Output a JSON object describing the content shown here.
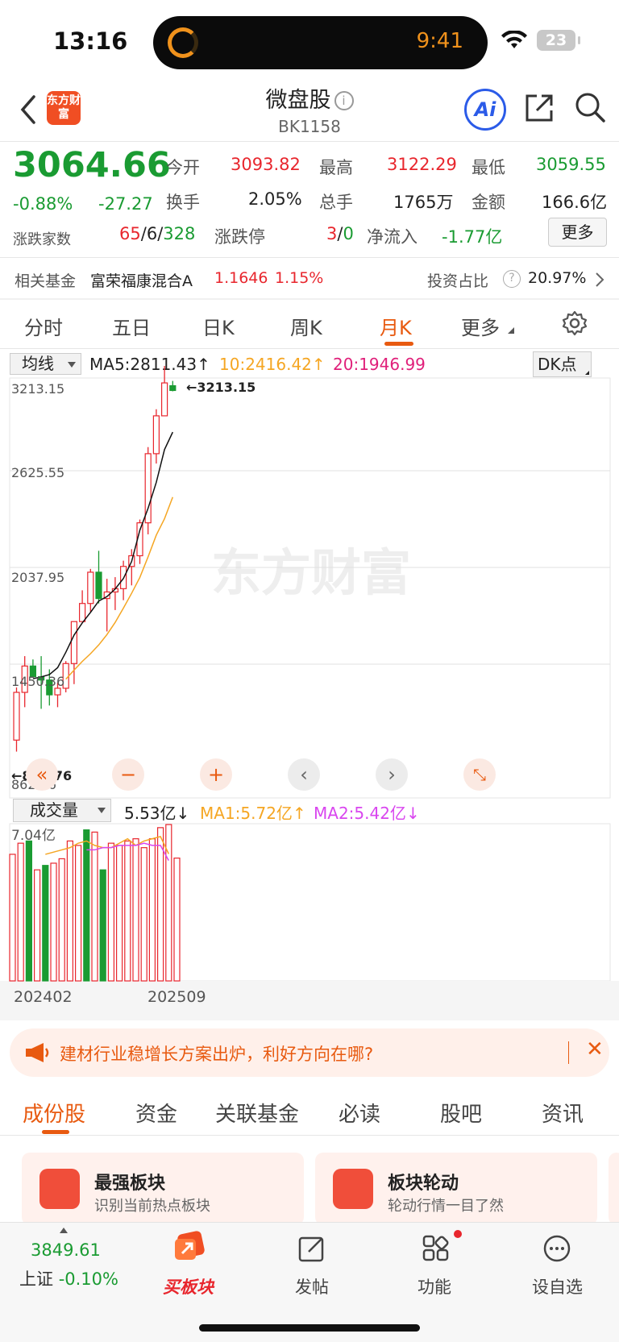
{
  "status_bar": {
    "time": "13:16",
    "island_time": "9:41",
    "battery": "23"
  },
  "header": {
    "logo": "东方财富",
    "title": "微盘股",
    "code": "BK1158",
    "ai_label": "Ai",
    "icons": [
      "back-icon",
      "info-icon",
      "ai-icon",
      "share-icon",
      "search-icon"
    ]
  },
  "quote": {
    "price": "3064.66",
    "change_pct": "-0.88%",
    "change": "-27.27",
    "open_label": "今开",
    "open": "3093.82",
    "high_label": "最高",
    "high": "3122.29",
    "low_label": "最低",
    "low": "3059.55",
    "turnover_label": "换手",
    "turnover": "2.05%",
    "volume_label": "总手",
    "volume": "1765万",
    "amount_label": "金额",
    "amount": "166.6亿",
    "breadth_label": "涨跌家数",
    "breadth_up": "65",
    "breadth_sep1": "/",
    "breadth_flat": "6",
    "breadth_sep2": "/",
    "breadth_down": "328",
    "limit_label": "涨跌停",
    "limit_up": "3",
    "limit_sep": "/",
    "limit_down": "0",
    "netflow_label": "净流入",
    "netflow": "-1.77亿",
    "more_button": "更多"
  },
  "fund": {
    "label": "相关基金",
    "name": "富荣福康混合A",
    "nav": "1.1646",
    "change": "1.15%",
    "ratio_label": "投资占比",
    "ratio": "20.97%"
  },
  "chart_tabs": [
    "分时",
    "五日",
    "日K",
    "周K",
    "月K",
    "更多"
  ],
  "active_chart_tab": "月K",
  "indicators": {
    "ma_select": "均线",
    "ma5": "MA5:2811.43",
    "ma10": "10:2416.42",
    "ma20": "20:1946.99",
    "dk_button": "DK点",
    "vol_select": "成交量",
    "vol": "5.53亿",
    "vol_ma1": "MA1:5.72亿",
    "vol_ma2": "MA2:5.42亿",
    "vol_max": "7.04亿"
  },
  "chart_data": {
    "type": "candlestick",
    "period": "monthly",
    "y_ticks": [
      "3213.15",
      "2625.55",
      "2037.95",
      "1450.36",
      "862.76"
    ],
    "ylim": [
      862.76,
      3213.15
    ],
    "max_marker": "3213.15",
    "min_marker": "862.76",
    "x_ticks": [
      "202402",
      "202509"
    ],
    "candles": [
      {
        "o": 940,
        "h": 1260,
        "l": 870,
        "c": 1230
      },
      {
        "o": 1230,
        "h": 1450,
        "l": 1140,
        "c": 1390
      },
      {
        "o": 1390,
        "h": 1430,
        "l": 1330,
        "c": 1325
      },
      {
        "o": 1325,
        "h": 1450,
        "l": 1130,
        "c": 1305
      },
      {
        "o": 1305,
        "h": 1370,
        "l": 1150,
        "c": 1215
      },
      {
        "o": 1215,
        "h": 1290,
        "l": 1140,
        "c": 1255
      },
      {
        "o": 1255,
        "h": 1420,
        "l": 1230,
        "c": 1405
      },
      {
        "o": 1405,
        "h": 1660,
        "l": 1280,
        "c": 1660
      },
      {
        "o": 1660,
        "h": 1850,
        "l": 1700,
        "c": 1770
      },
      {
        "o": 1770,
        "h": 1980,
        "l": 1720,
        "c": 1960
      },
      {
        "o": 1960,
        "h": 2090,
        "l": 1770,
        "c": 1800
      },
      {
        "o": 1800,
        "h": 1920,
        "l": 1600,
        "c": 1840
      },
      {
        "o": 1840,
        "h": 1930,
        "l": 1730,
        "c": 1860
      },
      {
        "o": 1860,
        "h": 2030,
        "l": 1790,
        "c": 1995
      },
      {
        "o": 1995,
        "h": 2100,
        "l": 1880,
        "c": 2060
      },
      {
        "o": 2060,
        "h": 2280,
        "l": 2010,
        "c": 2260
      },
      {
        "o": 2260,
        "h": 2720,
        "l": 2190,
        "c": 2680
      },
      {
        "o": 2680,
        "h": 2950,
        "l": 2620,
        "c": 2910
      },
      {
        "o": 2910,
        "h": 3213,
        "l": 2920,
        "c": 3110
      },
      {
        "o": 3093,
        "h": 3122,
        "l": 3059,
        "c": 3064
      }
    ],
    "ma5_line": [
      1313,
      1324,
      1338,
      1380,
      1474,
      1578,
      1652,
      1716,
      1785,
      1812,
      1858,
      1922,
      2025,
      2215,
      2348,
      2506,
      2705,
      2811
    ],
    "ma10_line": [
      1310,
      1365,
      1418,
      1465,
      1518,
      1581,
      1655,
      1742,
      1832,
      1928,
      2053,
      2185,
      2285,
      2416
    ],
    "volumes": [
      5.7,
      6.2,
      6.3,
      5.0,
      5.2,
      5.3,
      5.5,
      6.3,
      6.1,
      6.8,
      6.7,
      5.0,
      6.2,
      6.1,
      6.3,
      6.4,
      6.0,
      6.4,
      6.9,
      7.04,
      5.53
    ],
    "volume_up": [
      true,
      true,
      false,
      true,
      false,
      true,
      true,
      true,
      true,
      false,
      true,
      false,
      true,
      true,
      true,
      true,
      true,
      true,
      true,
      true,
      true
    ],
    "vol_ma1": [
      null,
      null,
      null,
      null,
      5.7,
      5.8,
      5.9,
      6.0,
      6.2,
      6.3,
      6.1,
      6.0,
      6.0,
      6.2,
      6.4,
      6.1,
      6.3,
      6.4,
      6.5,
      5.72
    ],
    "vol_ma2": [
      null,
      null,
      null,
      null,
      null,
      null,
      null,
      null,
      null,
      5.9,
      5.9,
      6.0,
      6.0,
      6.1,
      6.1,
      6.1,
      6.2,
      6.1,
      6.1,
      5.42
    ],
    "vol_ylim": [
      0,
      7.04
    ]
  },
  "banner": {
    "text": "建材行业稳增长方案出炉，利好方向在哪?"
  },
  "bottom_tabs": [
    "成份股",
    "资金",
    "关联基金",
    "必读",
    "股吧",
    "资讯"
  ],
  "active_bottom_tab": "成份股",
  "cards": [
    {
      "title": "最强板块",
      "subtitle": "识别当前热点板块"
    },
    {
      "title": "板块轮动",
      "subtitle": "轮动行情一目了然"
    }
  ],
  "nav": {
    "index_value": "3849.61",
    "index_name": "上证",
    "index_change": "-0.10%",
    "items": [
      "买板块",
      "发帖",
      "功能",
      "设自选"
    ]
  },
  "colors": {
    "up": "#e8262d",
    "down": "#1a9b32",
    "accent": "#e85a10",
    "ma10": "#f5a623",
    "ma20": "#e0207a",
    "vol_ma2": "#d946ef"
  }
}
